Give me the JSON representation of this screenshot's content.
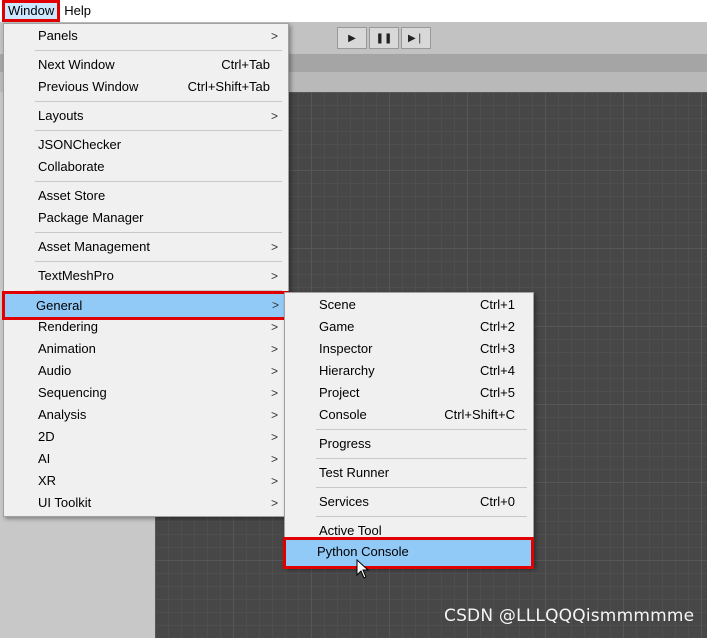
{
  "menubar": {
    "window_label": "Window",
    "help_label": "Help"
  },
  "playbar": {
    "play_glyph": "▶",
    "pause_glyph": "❚❚",
    "step_glyph": "▶❘"
  },
  "window_menu": {
    "panels": "Panels",
    "next_window": "Next Window",
    "next_window_sc": "Ctrl+Tab",
    "previous_window": "Previous Window",
    "previous_window_sc": "Ctrl+Shift+Tab",
    "layouts": "Layouts",
    "jsonchecker": "JSONChecker",
    "collaborate": "Collaborate",
    "asset_store": "Asset Store",
    "package_manager": "Package Manager",
    "asset_management": "Asset Management",
    "textmeshpro": "TextMeshPro",
    "general": "General",
    "rendering": "Rendering",
    "animation": "Animation",
    "audio": "Audio",
    "sequencing": "Sequencing",
    "analysis": "Analysis",
    "two_d": "2D",
    "ai": "AI",
    "xr": "XR",
    "ui_toolkit": "UI Toolkit",
    "arrow": ">"
  },
  "general_menu": {
    "scene": "Scene",
    "scene_sc": "Ctrl+1",
    "game": "Game",
    "game_sc": "Ctrl+2",
    "inspector": "Inspector",
    "inspector_sc": "Ctrl+3",
    "hierarchy": "Hierarchy",
    "hierarchy_sc": "Ctrl+4",
    "project": "Project",
    "project_sc": "Ctrl+5",
    "console": "Console",
    "console_sc": "Ctrl+Shift+C",
    "progress": "Progress",
    "test_runner": "Test Runner",
    "services": "Services",
    "services_sc": "Ctrl+0",
    "active_tool": "Active Tool",
    "python_console": "Python Console"
  },
  "watermark": "CSDN @LLLQQQismmmmme",
  "colors": {
    "highlight": "#91c9f7",
    "annotation_red": "#e00000",
    "menu_bg": "#f0f0f0"
  }
}
